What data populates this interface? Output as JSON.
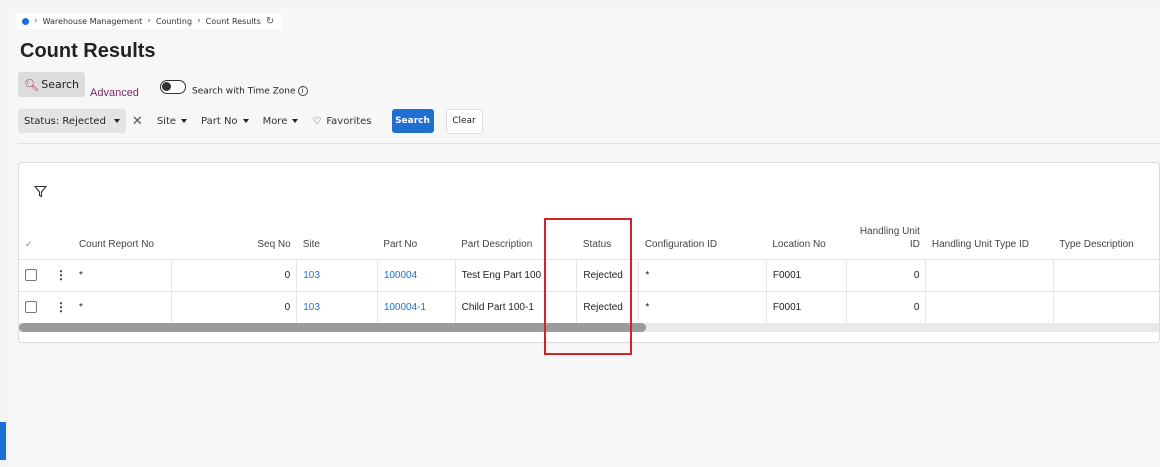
{
  "breadcrumb": {
    "items": [
      "Warehouse Management",
      "Counting",
      "Count Results"
    ],
    "home_icon": "home-dot-icon",
    "refresh_icon": "refresh-icon"
  },
  "page_title": "Count Results",
  "search_tabs": {
    "search": "Search",
    "advanced": "Advanced",
    "timezone_toggle_label": "Search with Time Zone",
    "info_glyph": "i"
  },
  "filters": {
    "status_chip": "Status: Rejected",
    "site": "Site",
    "part_no": "Part No",
    "more": "More",
    "favorites": "Favorites",
    "search_button": "Search",
    "clear_button": "Clear"
  },
  "table": {
    "columns": {
      "count_report_no": "Count Report No",
      "seq_no": "Seq No",
      "site": "Site",
      "part_no": "Part No",
      "part_description": "Part Description",
      "status": "Status",
      "configuration_id": "Configuration ID",
      "location_no": "Location No",
      "handling_unit_id": "Handling Unit ID",
      "handling_unit_type_id": "Handling Unit Type ID",
      "type_description": "Type Description"
    },
    "rows": [
      {
        "count_report_no": "*",
        "seq_no": "0",
        "site": "103",
        "part_no": "100004",
        "part_description": "Test  Eng Part 100",
        "status": "Rejected",
        "configuration_id": "*",
        "location_no": "F0001",
        "handling_unit_id": "0",
        "handling_unit_type_id": "",
        "type_description": ""
      },
      {
        "count_report_no": "*",
        "seq_no": "0",
        "site": "103",
        "part_no": "100004-1",
        "part_description": "Child Part 100-1",
        "status": "Rejected",
        "configuration_id": "*",
        "location_no": "F0001",
        "handling_unit_id": "0",
        "handling_unit_type_id": "",
        "type_description": ""
      }
    ]
  },
  "colors": {
    "accent": "#1e6fd1",
    "advanced_link": "#7a2a6c",
    "highlight": "#d2232a"
  }
}
